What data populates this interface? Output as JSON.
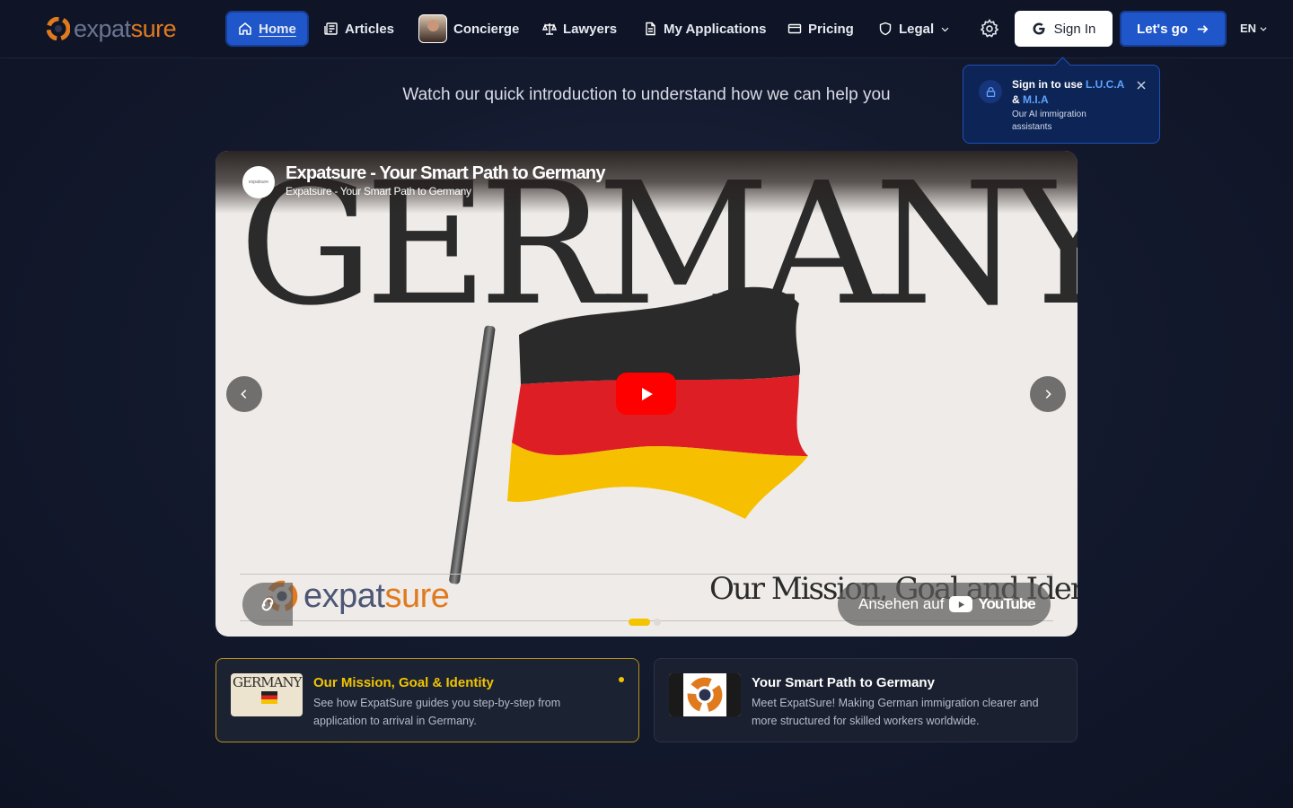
{
  "brand": {
    "name_part1": "expat",
    "name_part2": "sure",
    "accent": "#e07a1f"
  },
  "nav": {
    "items": [
      {
        "label": "Home",
        "icon": "home-icon"
      },
      {
        "label": "Articles",
        "icon": "newspaper-icon"
      },
      {
        "label": "Concierge",
        "icon": "concierge-avatar"
      },
      {
        "label": "Lawyers",
        "icon": "scale-icon"
      },
      {
        "label": "My Applications",
        "icon": "document-icon"
      },
      {
        "label": "Pricing",
        "icon": "credit-card-icon"
      },
      {
        "label": "Legal",
        "icon": "shield-icon"
      }
    ],
    "sign_in": "Sign In",
    "cta": "Let's go",
    "language": "EN"
  },
  "popover": {
    "title_prefix": "Sign in to use ",
    "assistant1": "L.U.C.A",
    "joiner": "& ",
    "assistant2": "M.I.A",
    "subtitle": "Our AI immigration assistants"
  },
  "intro_text": "Watch our quick introduction to understand how we can help you",
  "video": {
    "title": "Expatsure - Your Smart Path to Germany",
    "channel": "Expatsure - Your Smart Path to Germany",
    "headline": "GERMANY",
    "tagline": "Our Mission, Goal and Identity",
    "watch_on": "Ansehen auf",
    "platform": "YouTube",
    "logo_part1": "expat",
    "logo_part2": "sure"
  },
  "cards": [
    {
      "title": "Our Mission, Goal & Identity",
      "description": "See how ExpatSure guides you step-by-step from application to arrival in Germany.",
      "thumb_text": "GERMANY",
      "active": true
    },
    {
      "title": "Your Smart Path to Germany",
      "description": "Meet ExpatSure! Making German immigration clearer and more structured for skilled workers worldwide.",
      "active": false
    }
  ]
}
